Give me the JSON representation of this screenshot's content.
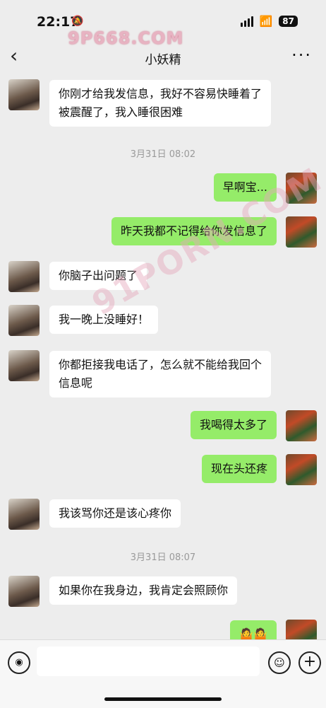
{
  "status": {
    "time": "22:17",
    "battery": "87"
  },
  "watermark": {
    "top": "9P668.COM",
    "diagonal": "91PORN.COM"
  },
  "header": {
    "title": "小妖精"
  },
  "messages": [
    {
      "side": "in",
      "text": "你刚才给我发信息，我好不容易快睡着了被震醒了，我入睡很困难"
    },
    {
      "side": "time",
      "text": "3月31日 08:02"
    },
    {
      "side": "out",
      "text": "早啊宝..."
    },
    {
      "side": "out",
      "text": "昨天我都不记得给你发信息了"
    },
    {
      "side": "in",
      "text": "你脑子出问题了"
    },
    {
      "side": "in",
      "text": "我一晚上没睡好！"
    },
    {
      "side": "in",
      "text": "你都拒接我电话了，怎么就不能给我回个信息呢"
    },
    {
      "side": "out",
      "text": "我喝得太多了"
    },
    {
      "side": "out",
      "text": "现在头还疼"
    },
    {
      "side": "in",
      "text": "我该骂你还是该心疼你"
    },
    {
      "side": "time",
      "text": "3月31日 08:07"
    },
    {
      "side": "in",
      "text": "如果你在我身边，我肯定会照顾你"
    },
    {
      "side": "out",
      "text": "🤷🤷"
    }
  ],
  "icons": {
    "back": "chevron-left-icon",
    "more": "more-dots-icon",
    "voice": "voice-icon",
    "emoji": "emoji-icon",
    "plus": "plus-icon"
  }
}
